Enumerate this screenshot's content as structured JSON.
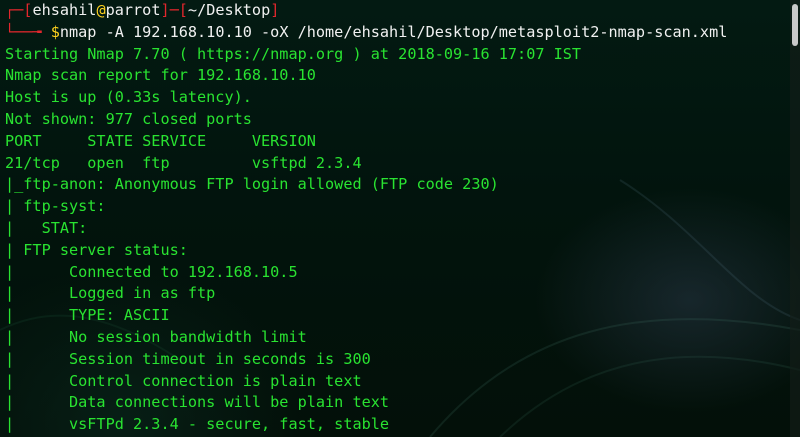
{
  "prompt": {
    "box_top": "┌─[",
    "user": "ehsahil",
    "at": "@",
    "host": "parrot",
    "sep": "]─[",
    "path": "~/Desktop",
    "close": "]",
    "box_bottom": "└──╼ ",
    "dollar": "$",
    "command": "nmap -A 192.168.10.10 -oX /home/ehsahil/Desktop/metasploit2-nmap-scan.xml"
  },
  "output": [
    "Starting Nmap 7.70 ( https://nmap.org ) at 2018-09-16 17:07 IST",
    "Nmap scan report for 192.168.10.10",
    "Host is up (0.33s latency).",
    "Not shown: 977 closed ports",
    "PORT     STATE SERVICE     VERSION",
    "21/tcp   open  ftp         vsftpd 2.3.4",
    "|_ftp-anon: Anonymous FTP login allowed (FTP code 230)",
    "| ftp-syst:",
    "|   STAT:",
    "| FTP server status:",
    "|      Connected to 192.168.10.5",
    "|      Logged in as ftp",
    "|      TYPE: ASCII",
    "|      No session bandwidth limit",
    "|      Session timeout in seconds is 300",
    "|      Control connection is plain text",
    "|      Data connections will be plain text",
    "|      vsFTPd 2.3.4 - secure, fast, stable"
  ],
  "colors": {
    "prompt_frame": "#e2272d",
    "prompt_text": "#f1f1f1",
    "dollar": "#ffd21e",
    "output": "#29e331",
    "background": "#02140d"
  }
}
